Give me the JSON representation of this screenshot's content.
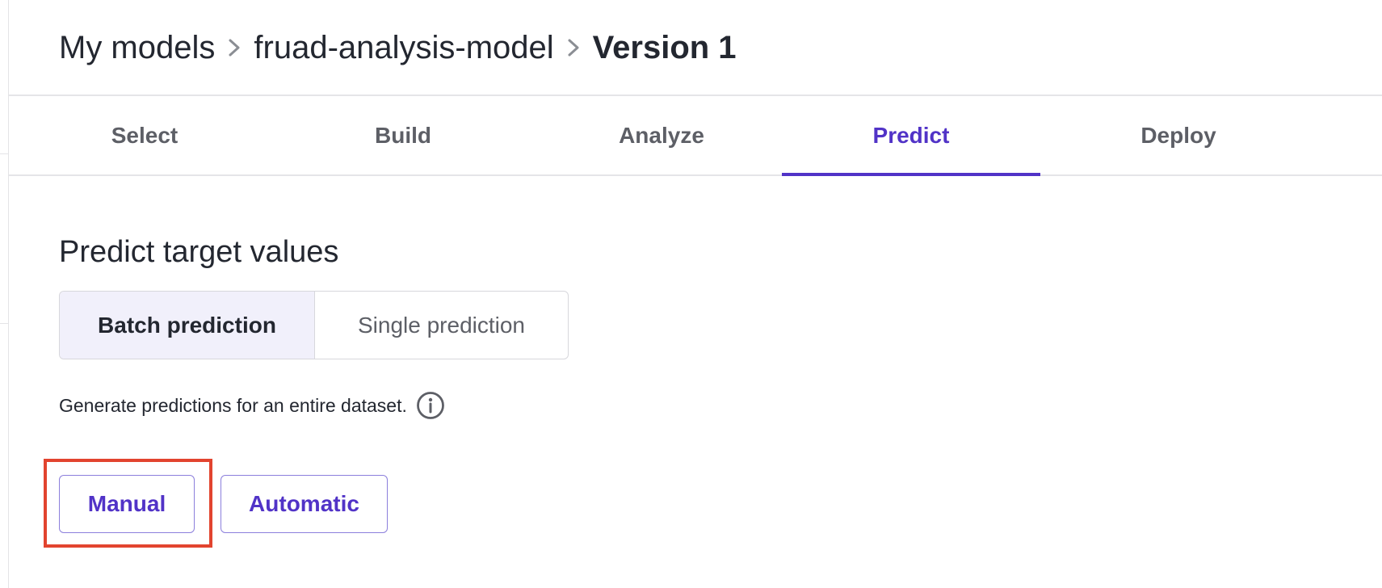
{
  "breadcrumb": {
    "items": [
      {
        "label": "My models"
      },
      {
        "label": "fruad-analysis-model"
      },
      {
        "label": "Version 1"
      }
    ]
  },
  "tabs": [
    {
      "label": "Select",
      "active": false
    },
    {
      "label": "Build",
      "active": false
    },
    {
      "label": "Analyze",
      "active": false
    },
    {
      "label": "Predict",
      "active": true
    },
    {
      "label": "Deploy",
      "active": false
    }
  ],
  "main": {
    "title": "Predict target values",
    "prediction_type": {
      "options": [
        "Batch prediction",
        "Single prediction"
      ],
      "selected": "Batch prediction"
    },
    "description": "Generate predictions for an entire dataset.",
    "mode_buttons": {
      "manual": "Manual",
      "automatic": "Automatic"
    }
  },
  "icons": {
    "breadcrumb_separator": "chevron-right-icon",
    "info": "info-icon"
  },
  "colors": {
    "accent": "#5133c7",
    "selected_segment_bg": "#f1f0fb",
    "highlight": "#e2442f",
    "text": "#232730",
    "muted_text": "#5d5f66",
    "border": "#e5e5e8"
  }
}
